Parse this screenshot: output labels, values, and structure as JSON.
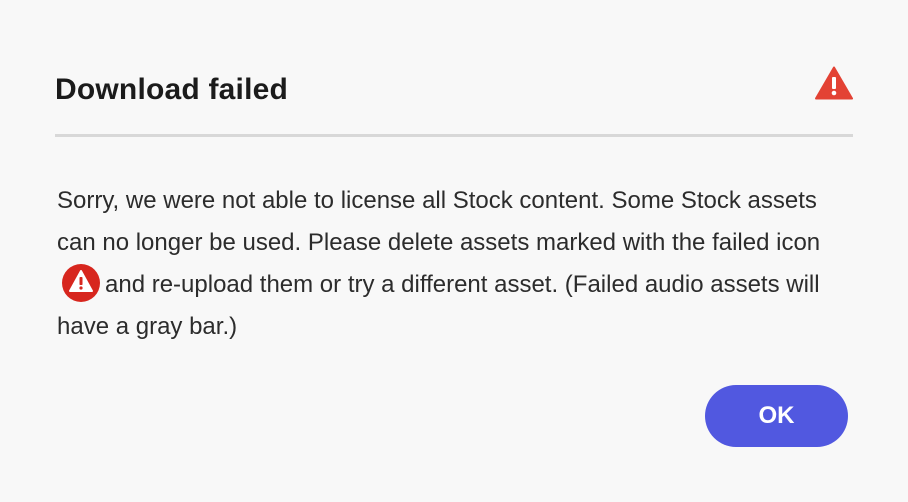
{
  "dialog": {
    "title": "Download failed",
    "header_icon": "alert-triangle-icon",
    "message_part1": "Sorry, we were not able to license all Stock content. Some Stock assets can no longer be used. Please delete assets marked with the failed icon",
    "inline_icon": "failed-alert-icon",
    "message_part2": "and re-upload them or try a different asset. (Failed audio assets will have a gray bar.)",
    "ok_label": "OK"
  },
  "colors": {
    "background": "#f8f8f8",
    "title_text": "#1b1b1b",
    "body_text": "#2c2c2c",
    "alert_red": "#e34234",
    "failed_icon_red": "#d7261e",
    "divider": "#d8d8d8",
    "button_bg": "#5158e0",
    "button_text": "#ffffff"
  }
}
